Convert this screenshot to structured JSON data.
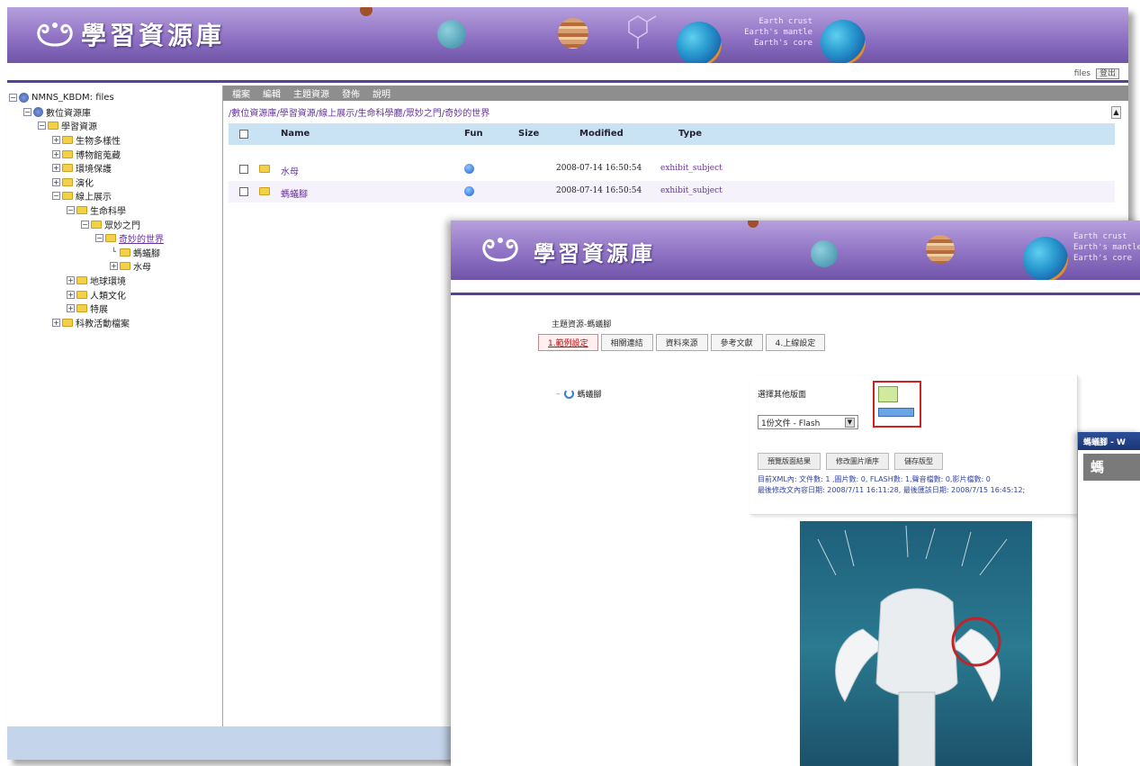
{
  "app": {
    "title": "學習資源庫",
    "earth_layers": [
      "Earth crust",
      "Earth's mantle",
      "Earth's core"
    ],
    "user_name": "files",
    "logout_label": "登出",
    "colors": {
      "banner": "#8f72c4",
      "accent_line": "#5a3f98",
      "header_row": "#c9e3f5",
      "link": "#663399",
      "active_tab": "#cc0000"
    }
  },
  "tree": {
    "nodes": [
      {
        "label": "NMNS_KBDM: files",
        "icon": "database-icon",
        "toggle": "−",
        "level": 0
      },
      {
        "label": "數位資源庫",
        "icon": "database-icon",
        "toggle": "−",
        "level": 1
      },
      {
        "label": "學習資源",
        "icon": "folder-icon",
        "toggle": "−",
        "level": 2
      },
      {
        "label": "生物多樣性",
        "icon": "folder-icon",
        "toggle": "+",
        "level": 3
      },
      {
        "label": "博物館蒐藏",
        "icon": "folder-icon",
        "toggle": "+",
        "level": 3
      },
      {
        "label": "環境保護",
        "icon": "folder-icon",
        "toggle": "+",
        "level": 3
      },
      {
        "label": "演化",
        "icon": "folder-icon",
        "toggle": "+",
        "level": 3
      },
      {
        "label": "線上展示",
        "icon": "folder-icon",
        "toggle": "−",
        "level": 3
      },
      {
        "label": "生命科學",
        "icon": "folder-icon",
        "toggle": "−",
        "level": 4
      },
      {
        "label": "眾妙之門",
        "icon": "folder-icon",
        "toggle": "−",
        "level": 5
      },
      {
        "label": "奇妙的世界",
        "icon": "folder-icon",
        "toggle": "−",
        "level": 6
      },
      {
        "label": "螞蟻腳",
        "icon": "folder-icon",
        "toggle": "",
        "level": 7
      },
      {
        "label": "水母",
        "icon": "folder-icon",
        "toggle": "+",
        "level": 7
      },
      {
        "label": "地球環境",
        "icon": "folder-icon",
        "toggle": "+",
        "level": 4
      },
      {
        "label": "人類文化",
        "icon": "folder-icon",
        "toggle": "+",
        "level": 4
      },
      {
        "label": "特展",
        "icon": "folder-icon",
        "toggle": "+",
        "level": 4
      },
      {
        "label": "科教活動檔案",
        "icon": "folder-icon",
        "toggle": "+",
        "level": 3
      }
    ]
  },
  "menubar": {
    "items": [
      "檔案",
      "編輯",
      "主題資源",
      "發佈",
      "說明"
    ]
  },
  "file_pane": {
    "path": "/數位資源庫/學習資源/線上展示/生命科學廳/眾妙之門/奇妙的世界",
    "columns": {
      "name": "Name",
      "fun": "Fun",
      "size": "Size",
      "modified": "Modified",
      "type": "Type"
    },
    "rows": [
      {
        "name": "水母",
        "size": "",
        "modified": "2008-07-14 16:50:54",
        "type": "exhibit_subject"
      },
      {
        "name": "螞蟻腳",
        "size": "",
        "modified": "2008-07-14 16:50:54",
        "type": "exhibit_subject"
      }
    ]
  },
  "editor": {
    "title": "學習資源庫",
    "earth_layers": [
      "Earth crust",
      "Earth's mantle",
      "Earth's core"
    ],
    "breadcrumb": "主題資源-螞蟻腳",
    "tabs": [
      "1.範例設定",
      "相關連結",
      "資料來源",
      "參考文獻",
      "4.上線設定"
    ],
    "active_tab": 0,
    "tree_item": "螞蟻腳",
    "select_label": "選擇其他版面",
    "select_value": "1份文件 - Flash",
    "buttons": [
      "預覽版面結果",
      "修改圖片順序",
      "儲存版型"
    ],
    "stats_line1": "目前XML內: 文件數: 1 ,圖片數: 0, FLASH數: 1,聲音檔數: 0,影片檔數: 0",
    "stats_line2": "最後修改文內容日期: 2008/7/11 16:11:28, 最後匯該日期: 2008/7/15 16:45:12;"
  },
  "third_window": {
    "title": "螞蟻腳 - W",
    "body_text": "螞"
  }
}
